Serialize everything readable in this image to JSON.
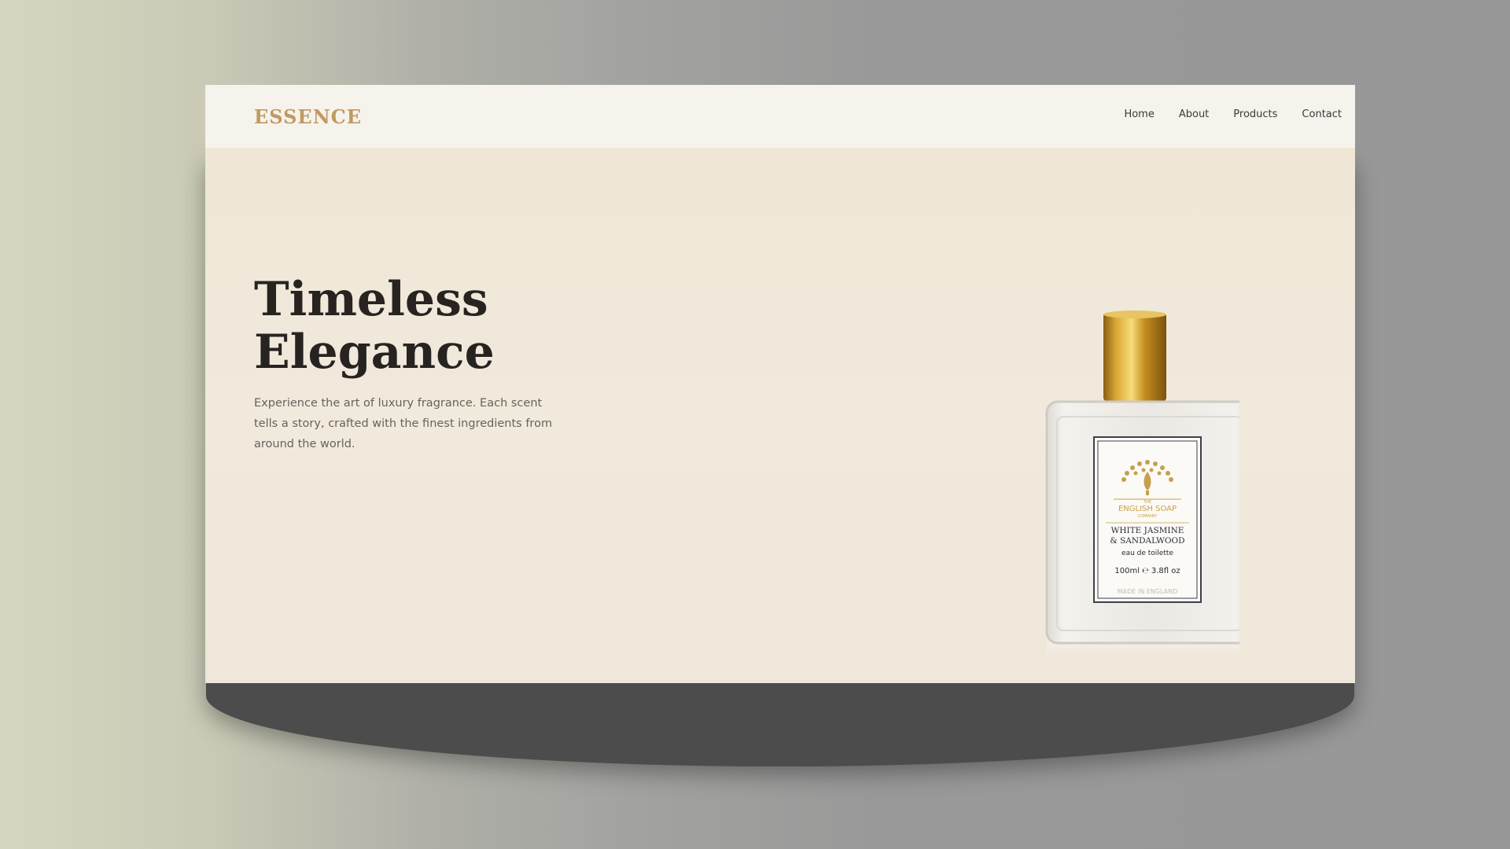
{
  "header": {
    "logo": "ESSENCE",
    "nav": [
      {
        "label": "Home"
      },
      {
        "label": "About"
      },
      {
        "label": "Products"
      },
      {
        "label": "Contact"
      }
    ]
  },
  "hero": {
    "title_line1": "Timeless",
    "title_line2": "Elegance",
    "description": "Experience the art of luxury fragrance. Each scent tells a story, crafted with the finest ingredients from around the world."
  },
  "product_label": {
    "brand_top": "THE",
    "brand_main": "ENGLISH SOAP",
    "brand_sub": "COMPANY",
    "scent_line1": "WHITE JASMINE",
    "scent_line2": "& SANDALWOOD",
    "type": "eau de toilette",
    "volume": "100ml ℮ 3.8fl oz",
    "origin": "MADE IN ENGLAND"
  },
  "colors": {
    "brand_gold": "#c09a62",
    "hero_bg": "#efe7d8",
    "nav_bg": "#f6f2ec",
    "heading": "#262320"
  }
}
